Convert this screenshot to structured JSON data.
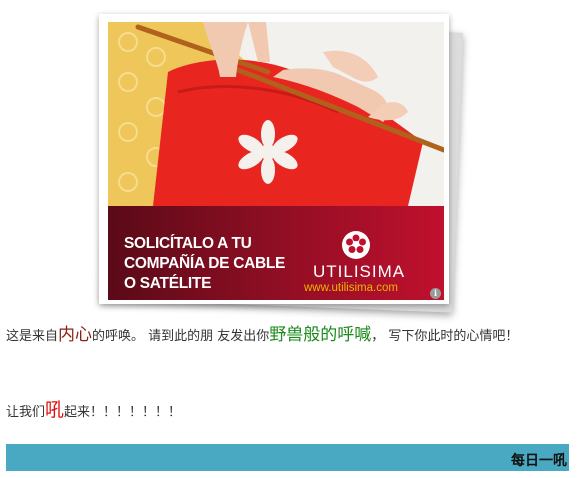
{
  "ad": {
    "headline_lines": [
      "SOLICÍTALO A TU",
      "COMPAÑÍA DE CABLE",
      "O SATÉLITE"
    ],
    "brand": "UTILISIMA",
    "url": "www.utilisima.com",
    "info_label": "i",
    "colors": {
      "band": "#8a0e22",
      "url": "#f0b400",
      "sweater": "#e8251f"
    }
  },
  "intro": {
    "part1": "这是来自",
    "inner_heart": "内心",
    "part2": "的呼唤。 请到此的朋 友发出你",
    "wild_call": "野兽般的呼喊",
    "part3": "， 写下你此时的心情吧！"
  },
  "shout": {
    "part1": "让我们",
    "roar": "吼",
    "part2": "起来！！！！！！！"
  },
  "section": {
    "title": "每日一吼"
  }
}
